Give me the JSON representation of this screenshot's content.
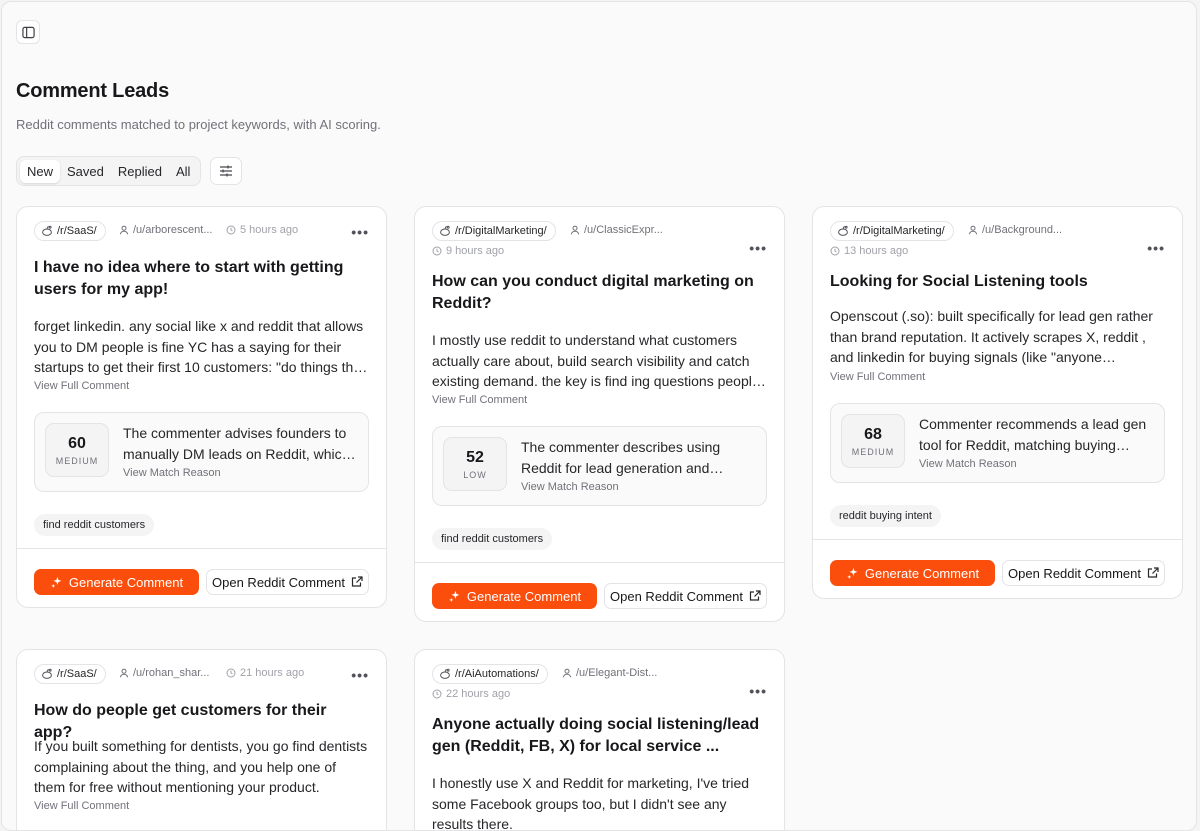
{
  "page": {
    "title": "Comment Leads",
    "subtitle": "Reddit comments matched to project keywords, with AI scoring."
  },
  "tabs": [
    {
      "label": "New",
      "active": true
    },
    {
      "label": "Saved"
    },
    {
      "label": "Replied"
    },
    {
      "label": "All"
    }
  ],
  "icons": {
    "sidebar_toggle": "sidebar-icon",
    "filter": "sliders-icon",
    "subreddit": "reddit-icon",
    "user": "user-icon",
    "time": "clock-icon",
    "generate": "sparkles-icon",
    "open": "external-link-icon"
  },
  "colors": {
    "accent": "#fb4d0b"
  },
  "card_labels": {
    "view_full": "View Full Comment",
    "view_reason": "View Match Reason",
    "generate": "Generate Comment",
    "open": "Open Reddit Comment",
    "more": "•••"
  },
  "cards": [
    {
      "subreddit": "/r/SaaS/",
      "user": "/u/arborescent...",
      "time": "5 hours ago",
      "title": "I have no idea where to start with getting users for my app!",
      "body": "forget linkedin. any social like x and reddit that allows you to DM people is fine YC has a saying for their startups to get their first 10 customers: \"do things that don't scale\"",
      "score": "60",
      "level": "MEDIUM",
      "reason": "The commenter advises founders to manually DM leads on Reddit, which matches the keyword.",
      "keyword": "find reddit customers"
    },
    {
      "subreddit": "/r/DigitalMarketing/",
      "user": "/u/ClassicExpr...",
      "time": "9 hours ago",
      "title": "How can you conduct digital marketing on Reddit?",
      "body": "I mostly use reddit to understand what customers actually care about, build search visibility and catch existing demand. the key is find ing questions people already ask.",
      "score": "52",
      "level": "LOW",
      "reason": "The commenter describes using Reddit for lead generation and customer discovery.",
      "keyword": "find reddit customers"
    },
    {
      "subreddit": "/r/DigitalMarketing/",
      "user": "/u/Background...",
      "time": "13 hours ago",
      "title": "Looking for Social Listening tools",
      "body": "Openscout (.so): built specifically for lead gen rather than brand reputation. It actively scrapes X, reddit , and linkedin for buying signals (like \"anyone recommend a tool\").",
      "score": "68",
      "level": "MEDIUM",
      "reason": "Commenter recommends a lead gen tool for Reddit, matching buying intent.",
      "keyword": "reddit buying intent"
    },
    {
      "subreddit": "/r/SaaS/",
      "user": "/u/rohan_shar...",
      "time": "21 hours ago",
      "title": "How do people get customers for their app?",
      "body": "If you built something for dentists, you go find dentists complaining about the thing, and you help one of them for free without mentioning your product."
    },
    {
      "subreddit": "/r/AiAutomations/",
      "user": "/u/Elegant-Dist...",
      "time": "22 hours ago",
      "title": "Anyone actually doing social listening/lead gen (Reddit, FB, X) for local service ...",
      "body": "I honestly use X and Reddit for marketing, I've tried some Facebook groups too, but I didn't see any results there."
    }
  ]
}
